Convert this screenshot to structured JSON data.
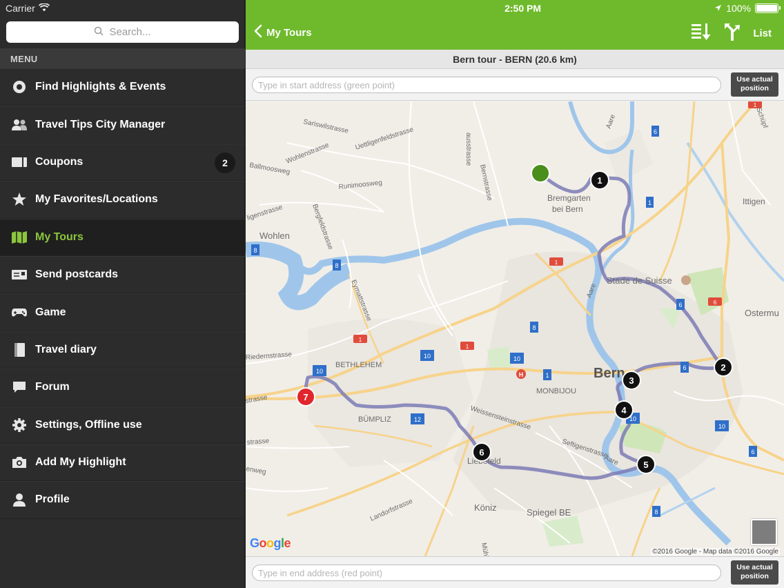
{
  "status": {
    "carrier": "Carrier",
    "time": "2:50 PM",
    "battery": "100%"
  },
  "search": {
    "placeholder": "Search..."
  },
  "menu": {
    "header": "MENU",
    "items": [
      {
        "label": "Find Highlights & Events",
        "icon": "target-icon"
      },
      {
        "label": "Travel Tips City Manager",
        "icon": "people-icon"
      },
      {
        "label": "Coupons",
        "icon": "ticket-icon",
        "badge": "2"
      },
      {
        "label": "My Favorites/Locations",
        "icon": "star-icon"
      },
      {
        "label": "My Tours",
        "icon": "map-icon",
        "active": true
      },
      {
        "label": "Send postcards",
        "icon": "postcard-icon"
      },
      {
        "label": "Game",
        "icon": "gamepad-icon"
      },
      {
        "label": "Travel diary",
        "icon": "book-icon"
      },
      {
        "label": "Forum",
        "icon": "chat-icon"
      },
      {
        "label": "Settings, Offline use",
        "icon": "gear-icon"
      },
      {
        "label": "Add My Highlight",
        "icon": "camera-icon"
      },
      {
        "label": "Profile",
        "icon": "person-icon"
      }
    ]
  },
  "nav": {
    "back_label": "My Tours",
    "list_label": "List"
  },
  "tour": {
    "title": "Bern tour - BERN (20.6 km)",
    "start_placeholder": "Type in start address (green point)",
    "end_placeholder": "Type in end address (red point)",
    "use_position_line1": "Use actual",
    "use_position_line2": "position"
  },
  "map": {
    "places": {
      "bremgarten1": "Bremgarten",
      "bremgarten2": "bei Bern",
      "ittigen": "Ittigen",
      "wohlen": "Wohlen",
      "stade": "Stade de Suisse",
      "ostermu": "Ostermu",
      "bern": "Bern",
      "bethlehem": "BETHLEHEM",
      "monbijou": "MONBIJOU",
      "bumpliz": "BÜMPLIZ",
      "liebefeld": "Liebefeld",
      "koniz": "Köniz",
      "spiegel": "Spiegel BE"
    },
    "streets": {
      "ausstrasse": "ausstrasse",
      "sariswil": "Sariswilstrasse",
      "uettligen": "Uettligenfeldstrasse",
      "wohlenstr": "Wohlenstrasse",
      "ballmoos": "Ballmoosweg",
      "runimoos": "Runimoosweg",
      "bernstr": "Bernstrasse",
      "ligenstr": "ligenstrasse",
      "bergfeld": "Bergfeldstrasse",
      "eymatt": "Eymattstrasse",
      "riedern": "Riedernstrasse",
      "strasse": "strasse",
      "weissenstein": "Weissensteinstrasse",
      "seftigen": "Seftigenstrasse",
      "landorf": "Landorfstrasse",
      "aare": "Aare",
      "schupf": "Schüpf",
      "enweg": "enweg",
      "muhle": "Mühle"
    },
    "tour_stops": [
      "1",
      "2",
      "3",
      "4",
      "5",
      "6",
      "7"
    ],
    "start_color": "#4a8e1c",
    "end_color": "#e0262c",
    "route_color": "#7b7bb5",
    "copyright": "©2016 Google - Map data ©2016 Google",
    "logo": "Google"
  },
  "colors": {
    "accent": "#6fba2c",
    "active_menu_text": "#8cc63e",
    "sidebar_bg": "#2c2c2c"
  }
}
